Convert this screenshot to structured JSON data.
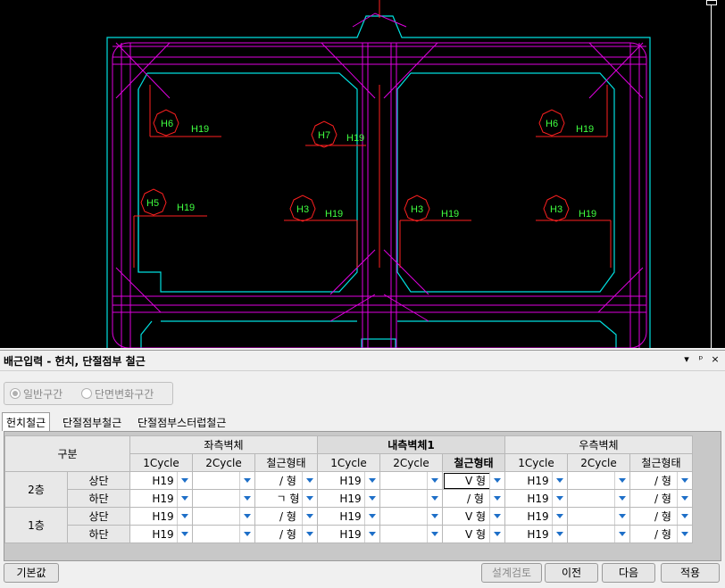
{
  "cad": {
    "labels": [
      {
        "id": "H6",
        "text": "H6",
        "rebar": "H19"
      },
      {
        "id": "H7",
        "text": "H7",
        "rebar": "H19"
      },
      {
        "id": "H6b",
        "text": "H6",
        "rebar": "H19"
      },
      {
        "id": "H5",
        "text": "H5",
        "rebar": "H19"
      },
      {
        "id": "H3a",
        "text": "H3",
        "rebar": "H19"
      },
      {
        "id": "H3b",
        "text": "H3",
        "rebar": "H19"
      },
      {
        "id": "H3c",
        "text": "H3",
        "rebar": "H19"
      }
    ]
  },
  "panel": {
    "title": "배근입력 - 헌치, 단절점부 철근",
    "controls": {
      "dropdown": "▾",
      "pin": "ᵖ",
      "close": "×"
    },
    "radios": [
      {
        "label": "일반구간",
        "selected": true
      },
      {
        "label": "단면변화구간",
        "selected": false
      }
    ],
    "tabs": [
      {
        "label": "헌치철근",
        "active": true
      },
      {
        "label": "단절점부철근",
        "active": false
      },
      {
        "label": "단절점부스터럽철근",
        "active": false
      }
    ],
    "grid": {
      "header_group": "구분",
      "groups": [
        "좌측벽체",
        "내측벽체1",
        "우측벽체"
      ],
      "columns": [
        "1Cycle",
        "2Cycle",
        "철근형태"
      ],
      "rows": [
        {
          "floor": "2층",
          "pos": "상단",
          "left": [
            "H19",
            "",
            "/ 형"
          ],
          "inner": [
            "H19",
            "",
            "V 형"
          ],
          "right": [
            "H19",
            "",
            "/ 형"
          ]
        },
        {
          "floor": "",
          "pos": "하단",
          "left": [
            "H19",
            "",
            "ㄱ 형"
          ],
          "inner": [
            "H19",
            "",
            "/ 형"
          ],
          "right": [
            "H19",
            "",
            "/ 형"
          ]
        },
        {
          "floor": "1층",
          "pos": "상단",
          "left": [
            "H19",
            "",
            "/ 형"
          ],
          "inner": [
            "H19",
            "",
            "V 형"
          ],
          "right": [
            "H19",
            "",
            "/ 형"
          ]
        },
        {
          "floor": "",
          "pos": "하단",
          "left": [
            "H19",
            "",
            "/ 형"
          ],
          "inner": [
            "H19",
            "",
            "V 형"
          ],
          "right": [
            "H19",
            "",
            "/ 형"
          ]
        }
      ]
    },
    "buttons": {
      "default": "기본값",
      "check": "설계검토",
      "prev": "이전",
      "next": "다음",
      "apply": "적용"
    }
  }
}
